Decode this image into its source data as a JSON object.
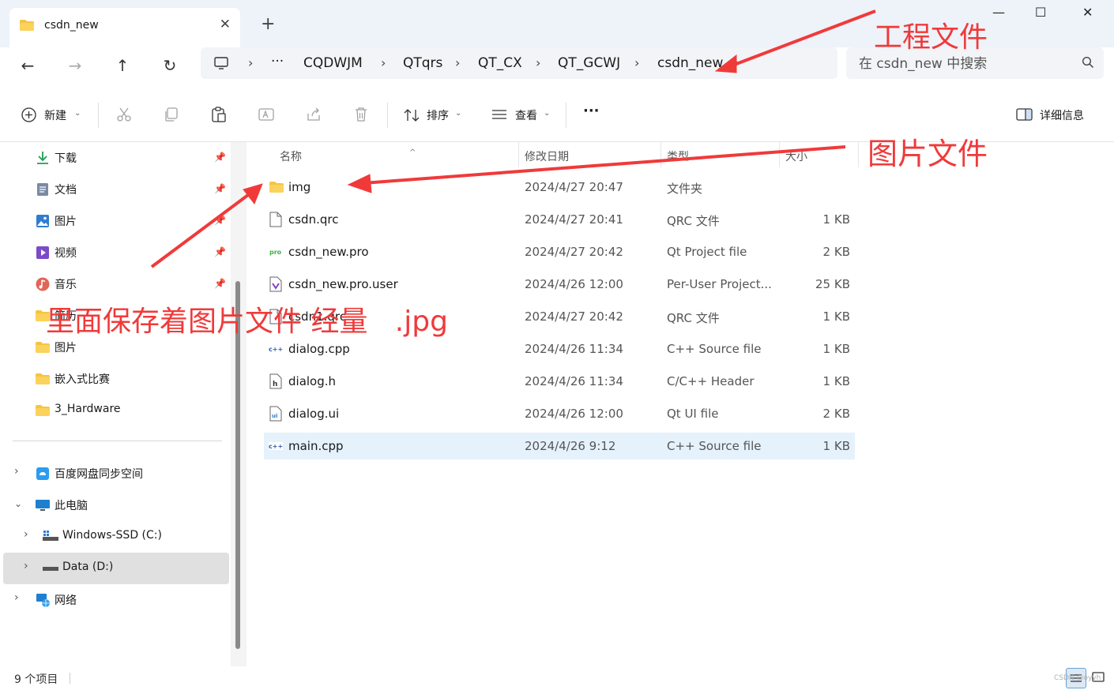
{
  "window": {
    "tab_title": "csdn_new",
    "tab_close": "✕",
    "new_tab": "+",
    "controls": {
      "minimize": "—",
      "maximize": "☐",
      "close": "✕"
    }
  },
  "nav": {
    "back": "←",
    "forward": "→",
    "up": "↑",
    "refresh": "↻"
  },
  "address": {
    "more": "···",
    "crumbs": [
      "CQDWJM",
      "QTqrs",
      "QT_CX",
      "QT_GCWJ",
      "csdn_new"
    ],
    "separator": "›"
  },
  "search": {
    "placeholder": "在 csdn_new 中搜索"
  },
  "toolbar": {
    "new_label": "新建",
    "sort_label": "排序",
    "view_label": "查看",
    "more": "···",
    "details_label": "详细信息"
  },
  "sidebar": {
    "quick_access": [
      {
        "label": "下载",
        "icon": "download-icon"
      },
      {
        "label": "文档",
        "icon": "document-icon"
      },
      {
        "label": "图片",
        "icon": "pictures-icon"
      },
      {
        "label": "视频",
        "icon": "videos-icon"
      },
      {
        "label": "音乐",
        "icon": "music-icon"
      },
      {
        "label": "简历",
        "icon": "folder-icon"
      },
      {
        "label": "图片",
        "icon": "folder-icon"
      },
      {
        "label": "嵌入式比赛",
        "icon": "folder-icon"
      },
      {
        "label": "3_Hardware",
        "icon": "folder-icon"
      }
    ],
    "tree": [
      {
        "label": "百度网盘同步空间",
        "icon": "baidu-netdisk-icon"
      },
      {
        "label": "此电脑",
        "icon": "computer-icon"
      },
      {
        "label": "Windows-SSD (C:)",
        "icon": "drive-c-icon"
      },
      {
        "label": "Data (D:)",
        "icon": "drive-d-icon"
      },
      {
        "label": "网络",
        "icon": "network-icon"
      }
    ]
  },
  "columns": {
    "name": "名称",
    "modified": "修改日期",
    "type": "类型",
    "size": "大小"
  },
  "files": [
    {
      "name": "img",
      "modified": "2024/4/27 20:47",
      "type": "文件夹",
      "size": "",
      "icon": "folder-icon"
    },
    {
      "name": "csdn.qrc",
      "modified": "2024/4/27 20:41",
      "type": "QRC 文件",
      "size": "1 KB",
      "icon": "file-icon"
    },
    {
      "name": "csdn_new.pro",
      "modified": "2024/4/27 20:42",
      "type": "Qt Project file",
      "size": "2 KB",
      "icon": "qt-pro-icon"
    },
    {
      "name": "csdn_new.pro.user",
      "modified": "2024/4/26 12:00",
      "type": "Per-User Project...",
      "size": "25 KB",
      "icon": "pro-user-icon"
    },
    {
      "name": "csdn1.qrc",
      "modified": "2024/4/27 20:42",
      "type": "QRC 文件",
      "size": "1 KB",
      "icon": "file-icon"
    },
    {
      "name": "dialog.cpp",
      "modified": "2024/4/26 11:34",
      "type": "C++ Source file",
      "size": "1 KB",
      "icon": "cpp-icon"
    },
    {
      "name": "dialog.h",
      "modified": "2024/4/26 11:34",
      "type": "C/C++ Header",
      "size": "1 KB",
      "icon": "header-icon"
    },
    {
      "name": "dialog.ui",
      "modified": "2024/4/26 12:00",
      "type": "Qt UI file",
      "size": "2 KB",
      "icon": "ui-file-icon"
    },
    {
      "name": "main.cpp",
      "modified": "2024/4/26 9:12",
      "type": "C++ Source file",
      "size": "1 KB",
      "icon": "cpp-icon"
    }
  ],
  "status": {
    "count": "9 个项目",
    "watermark": "CSDN @oyyh"
  },
  "annotations": {
    "project_files": "工程文件",
    "image_files": "图片文件",
    "note": "里面保存着图片文件 经量   .jpg"
  },
  "colors": {
    "accent": "#0067c0",
    "annotation": "#f03a3a",
    "folder": "#f6c443",
    "selection": "#e5f1fb"
  }
}
